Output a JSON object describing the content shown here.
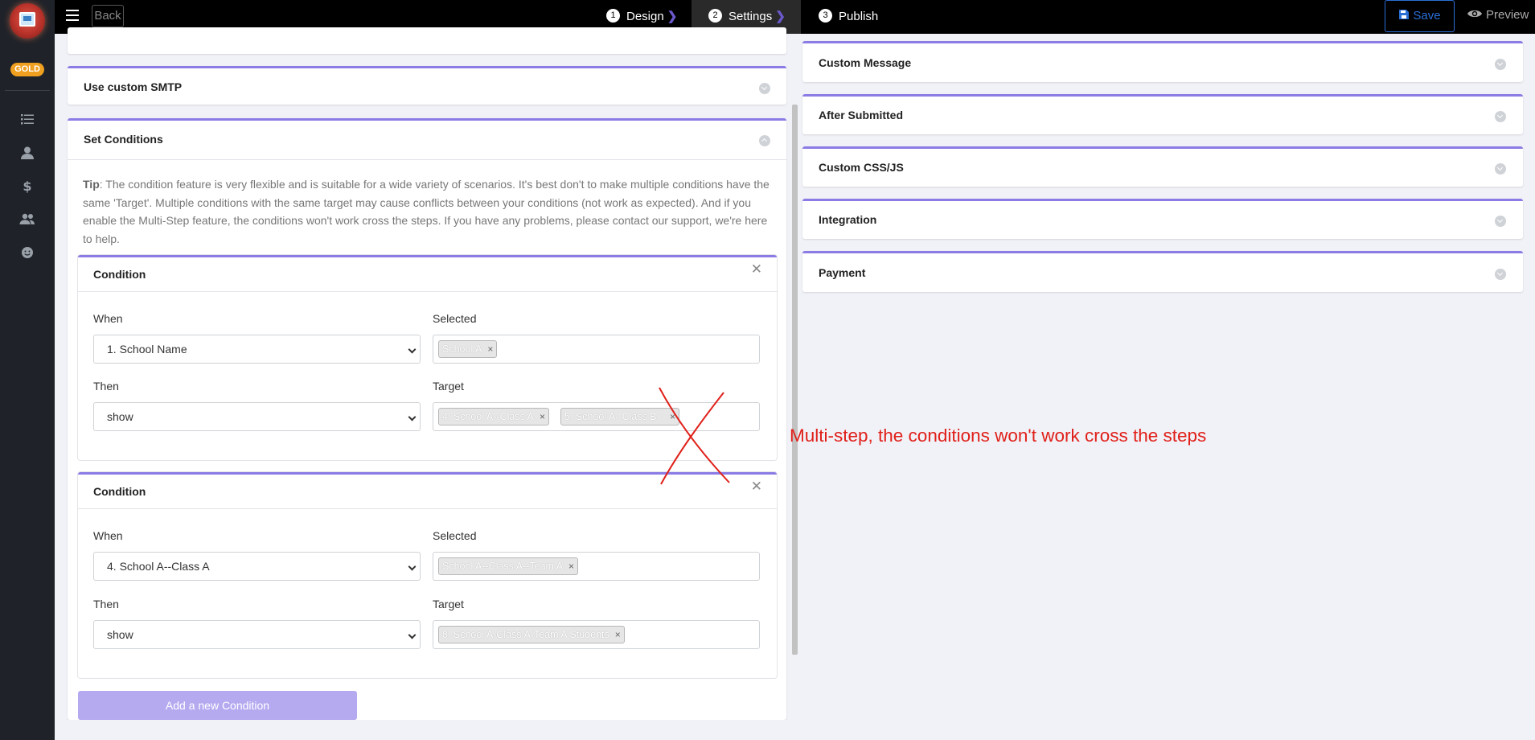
{
  "sidebar": {
    "badge": "GOLD",
    "icons": [
      "list-icon",
      "user-icon",
      "dollar-icon",
      "users-icon",
      "smile-icon"
    ]
  },
  "topbar": {
    "back_label": "Back",
    "steps": [
      {
        "num": "1",
        "label": "Design"
      },
      {
        "num": "2",
        "label": "Settings"
      },
      {
        "num": "3",
        "label": "Publish"
      }
    ],
    "active_step": "Settings",
    "save_label": "Save",
    "preview_label": "Preview"
  },
  "left_panels": {
    "smtp_title": "Use custom SMTP",
    "conditions_title": "Set Conditions",
    "tip_label": "Tip",
    "tip_text": ": The condition feature is very flexible and is suitable for a wide variety of scenarios. It's best don't to make multiple conditions have the same 'Target'. Multiple conditions with the same target may cause conflicts between your conditions (not work as expected). And if you enable the Multi-Step feature, the conditions won't work cross the steps. If you have any problems, please contact our support, we're here to help."
  },
  "conditions": [
    {
      "title": "Condition",
      "when_label": "When",
      "when_value": "1. School Name",
      "selected_label": "Selected",
      "selected_tags": [
        "School A"
      ],
      "then_label": "Then",
      "then_value": "show",
      "target_label": "Target",
      "target_tags": [
        "4. School A--Class A",
        "5. School A--Class B"
      ]
    },
    {
      "title": "Condition",
      "when_label": "When",
      "when_value": "4. School A--Class A",
      "selected_label": "Selected",
      "selected_tags": [
        "School A--Class A--Team A"
      ],
      "then_label": "Then",
      "then_value": "show",
      "target_label": "Target",
      "target_tags": [
        "8. School A-Class A-Team A Students"
      ]
    }
  ],
  "add_condition_label": "Add a new Condition",
  "right_panels": [
    "Custom Message",
    "After Submitted",
    "Custom CSS/JS",
    "Integration",
    "Payment"
  ],
  "annotation": "Multi-step, the conditions won't work cross the steps",
  "colors": {
    "accent": "#8b7be5",
    "annotation": "#e0201a",
    "save": "#2a6fd6"
  }
}
